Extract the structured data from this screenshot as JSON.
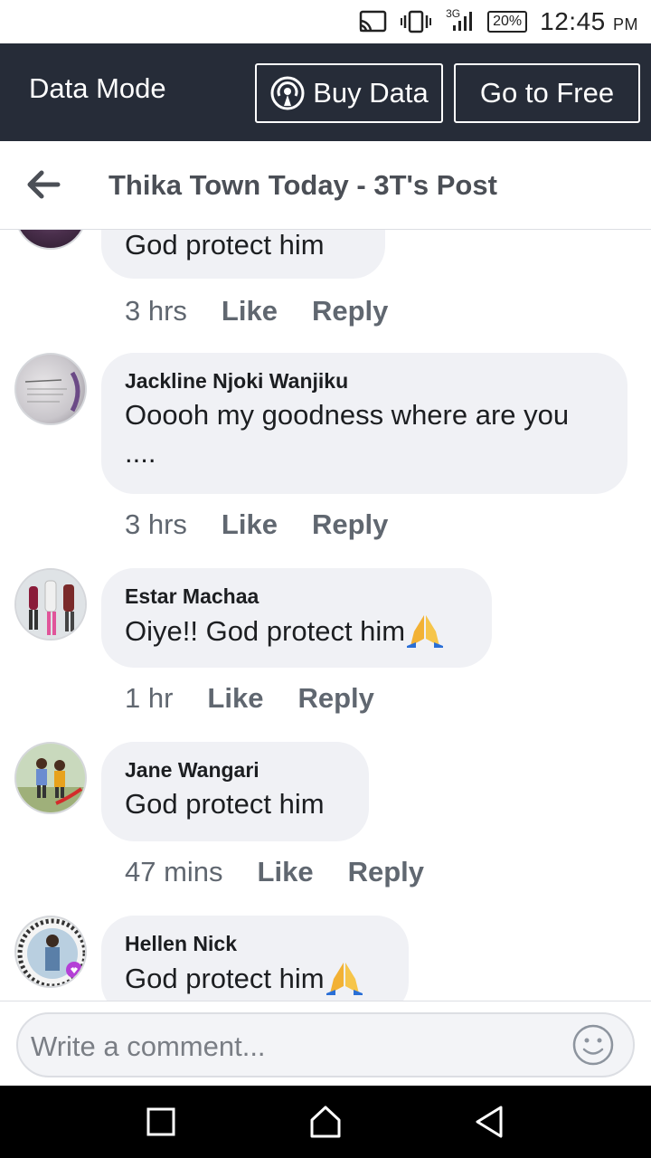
{
  "status_bar": {
    "icons": [
      "cast-icon",
      "vibrate-icon",
      "signal-3g-icon"
    ],
    "network": "3G",
    "battery": "20%",
    "time": "12:45",
    "ampm": "PM"
  },
  "data_bar": {
    "mode_label": "Data Mode",
    "buy_label": "Buy Data",
    "free_label": "Go to Free"
  },
  "header": {
    "title": "Thika Town Today - 3T's Post"
  },
  "comments": [
    {
      "name": "",
      "text": "God protect him",
      "time": "3 hrs",
      "like": "Like",
      "reply": "Reply"
    },
    {
      "name": "Jackline Njoki Wanjiku",
      "text": "Ooooh my goodness where are you",
      "text2": "....",
      "time": "3 hrs",
      "like": "Like",
      "reply": "Reply"
    },
    {
      "name": "Estar Machaa",
      "text": "Oiye!! God protect him",
      "time": "1 hr",
      "like": "Like",
      "reply": "Reply"
    },
    {
      "name": "Jane Wangari",
      "text": "God protect him",
      "time": "47 mins",
      "like": "Like",
      "reply": "Reply"
    },
    {
      "name": "Hellen Nick",
      "text": "God protect him"
    }
  ],
  "composer": {
    "placeholder": "Write a comment..."
  },
  "colors": {
    "data_bar_bg": "#262c38",
    "bubble_bg": "#f0f1f5",
    "meta_text": "#606770"
  }
}
